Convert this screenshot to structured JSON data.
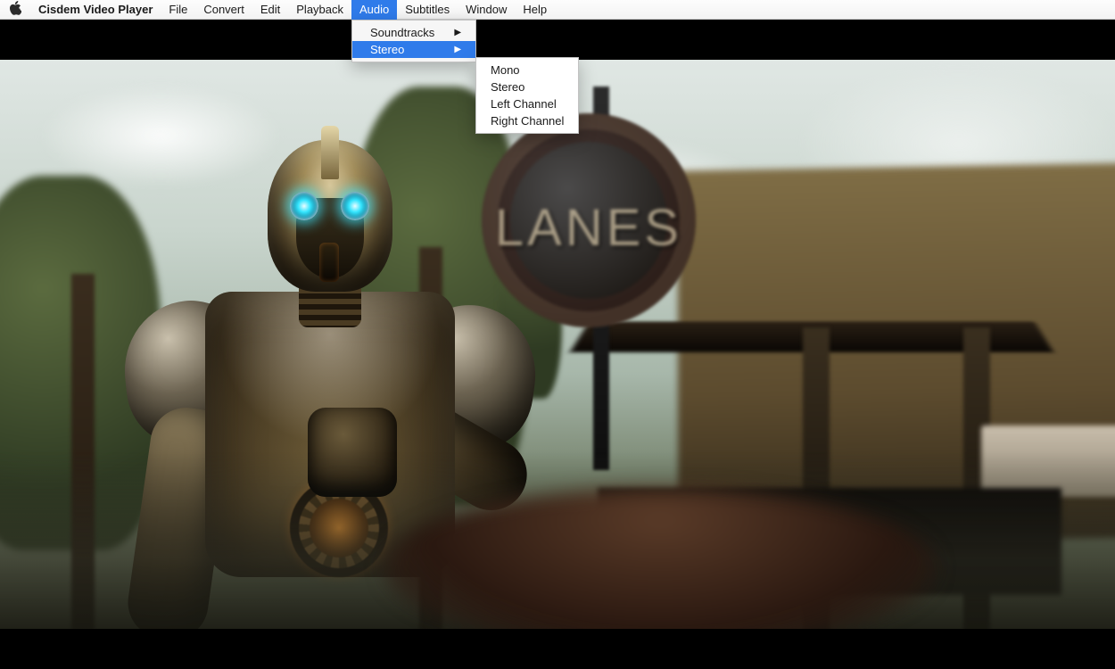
{
  "menubar": {
    "app_name": "Cisdem Video Player",
    "items": [
      "File",
      "Convert",
      "Edit",
      "Playback",
      "Audio",
      "Subtitles",
      "Window",
      "Help"
    ],
    "active_index": 4
  },
  "audio_menu": {
    "items": [
      {
        "label": "Soundtracks",
        "has_submenu": true,
        "highlight": false
      },
      {
        "label": "Stereo",
        "has_submenu": true,
        "highlight": true
      }
    ]
  },
  "stereo_submenu": {
    "items": [
      "Mono",
      "Stereo",
      "Left Channel",
      "Right Channel"
    ]
  },
  "scene": {
    "sign_text": "LANES"
  }
}
